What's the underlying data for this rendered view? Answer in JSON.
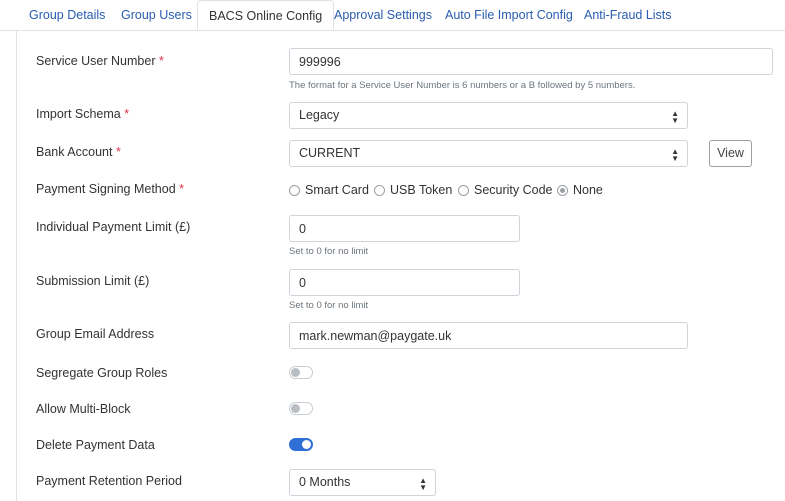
{
  "tabs": [
    {
      "label": "Group Details",
      "active": false
    },
    {
      "label": "Group Users",
      "active": false
    },
    {
      "label": "BACS Online Config",
      "active": true
    },
    {
      "label": "Approval Settings",
      "active": false
    },
    {
      "label": "Auto File Import Config",
      "active": false
    },
    {
      "label": "Anti-Fraud Lists",
      "active": false
    }
  ],
  "form": {
    "service_user_number": {
      "label": "Service User Number",
      "required": "*",
      "value": "999996",
      "help": "The format for a Service User Number is 6 numbers or a B followed by 5 numbers."
    },
    "import_schema": {
      "label": "Import Schema",
      "required": "*",
      "value": "Legacy"
    },
    "bank_account": {
      "label": "Bank Account",
      "required": "*",
      "value": "CURRENT",
      "view_label": "View"
    },
    "payment_signing_method": {
      "label": "Payment Signing Method",
      "required": "*",
      "options": [
        "Smart Card",
        "USB Token",
        "Security Code",
        "None"
      ],
      "selected": "None"
    },
    "individual_payment_limit": {
      "label": "Individual Payment Limit (£)",
      "value": "0",
      "help": "Set to 0 for no limit"
    },
    "submission_limit": {
      "label": "Submission Limit (£)",
      "value": "0",
      "help": "Set to 0 for no limit"
    },
    "group_email_address": {
      "label": "Group Email Address",
      "value": "mark.newman@paygate.uk"
    },
    "segregate_group_roles": {
      "label": "Segregate Group Roles",
      "enabled": false
    },
    "allow_multi_block": {
      "label": "Allow Multi-Block",
      "enabled": false
    },
    "delete_payment_data": {
      "label": "Delete Payment Data",
      "enabled": true
    },
    "payment_retention_period": {
      "label": "Payment Retention Period",
      "value": "0 Months"
    }
  },
  "colors": {
    "accent": "#2f6fd6",
    "link": "#2a5db0",
    "required": "#dc3545"
  }
}
